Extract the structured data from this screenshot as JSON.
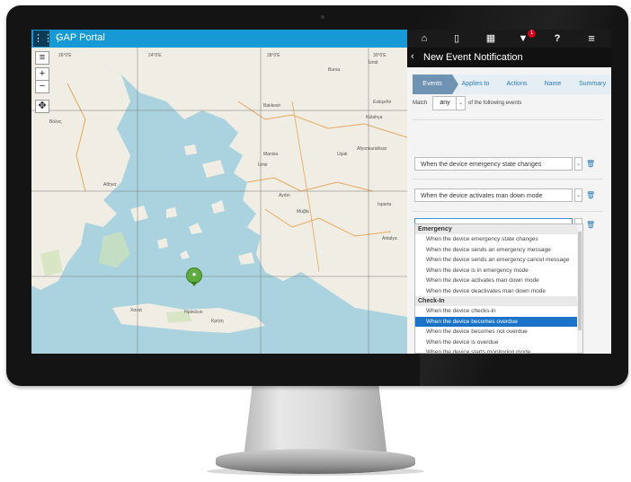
{
  "app": {
    "title": "GAP Portal",
    "grid_icon": "grid-icon"
  },
  "topnav": {
    "icons": [
      "home-icon",
      "phone-icon",
      "calendar-icon",
      "filter-icon",
      "help-icon",
      "menu-icon"
    ],
    "filter_badge": "1",
    "help_label": "?"
  },
  "map": {
    "zoom_in": "+",
    "zoom_out": "−",
    "layers_label": "≡",
    "labels": [
      {
        "t": "26°0'E",
        "id": "lon-26"
      },
      {
        "t": "28°0'E",
        "id": "lon-28"
      },
      {
        "t": "30°0'E",
        "id": "lon-30"
      },
      {
        "t": "24°0'E",
        "id": "lon-24"
      },
      {
        "t": "Balıkesir",
        "id": "balikesir"
      },
      {
        "t": "Eskişehir",
        "id": "eskisehir"
      },
      {
        "t": "Kütahya",
        "id": "kutahya"
      },
      {
        "t": "Manisa",
        "id": "manisa"
      },
      {
        "t": "İzmir",
        "id": "izmir"
      },
      {
        "t": "Uşak",
        "id": "usak"
      },
      {
        "t": "Afyonkarahisar",
        "id": "afyon"
      },
      {
        "t": "Aydın",
        "id": "aydin"
      },
      {
        "t": "Isparta",
        "id": "isparta"
      },
      {
        "t": "Muğla",
        "id": "mugla"
      },
      {
        "t": "Antalya",
        "id": "antalya"
      },
      {
        "t": "Βόλος",
        "id": "volos"
      },
      {
        "t": "Αθήνα",
        "id": "athens"
      },
      {
        "t": "Χανιά",
        "id": "chania"
      },
      {
        "t": "Ηράκλειο",
        "id": "heraklion"
      },
      {
        "t": "Κρήτη",
        "id": "crete"
      },
      {
        "t": "Bursa",
        "id": "bursa"
      },
      {
        "t": "İzmit",
        "id": "izmit"
      }
    ]
  },
  "panel": {
    "back_label": "‹",
    "title": "New Event Notification",
    "tabs": [
      {
        "label": "Events",
        "active": true
      },
      {
        "label": "Applies to",
        "active": false
      },
      {
        "label": "Actions",
        "active": false
      },
      {
        "label": "Name",
        "active": false
      },
      {
        "label": "Summary",
        "active": false
      }
    ],
    "match": {
      "prefix": "Match",
      "value": "any",
      "suffix": "of the following events"
    },
    "conditions": [
      {
        "value": "When the device emergency state changes"
      },
      {
        "value": "When the device activates man down mode"
      },
      {
        "value": ""
      }
    ],
    "dropdown": {
      "groups": [
        {
          "label": "Emergency",
          "items": [
            "When the device emergency state changes",
            "When the device sends an emergency message",
            "When the device sends an emergency cancel message",
            "When the device is in emergency mode",
            "When the device activates man down mode",
            "When the device deactivates man down mode"
          ]
        },
        {
          "label": "Check-In",
          "items": [
            "When the device checks-in",
            "When the device becomes overdue",
            "When the device becomes not overdue",
            "When the device is overdue",
            "When the device starts monitoring mode",
            "When the device stops monitoring mode or checks out"
          ]
        }
      ],
      "selected": "When the device becomes overdue"
    }
  }
}
